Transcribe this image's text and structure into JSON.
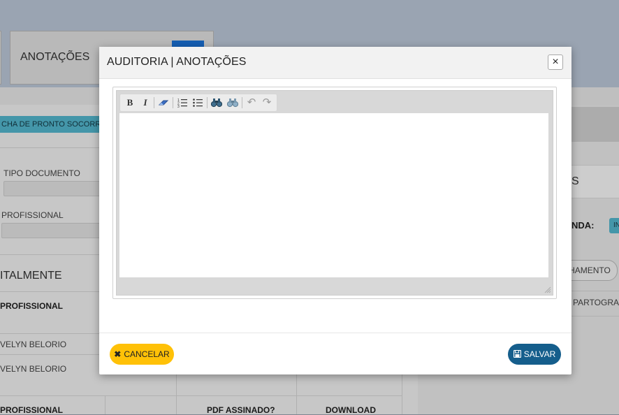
{
  "background": {
    "tab_label": "ANOTAÇÕES",
    "ficha_label": "CHA DE PRONTO SOCORRO (se",
    "tipo_documento_label": "TIPO DOCUMENTO",
    "profissional_label": "PROFISSIONAL",
    "section_title": "ITALMENTE",
    "col_profissional": "PROFISSIONAL",
    "row1_name": "VELYN BELORIO",
    "row2_name": "VELYN BELORIO",
    "col_profissional_2": "PROFISSIONAL",
    "col_pdf_assinado": "PDF ASSINADO?",
    "col_download": "DOWNLOAD",
    "right_s": "S",
    "right_nda": "NDA:",
    "right_badge": "IN",
    "right_pill": "HAMENTO",
    "right_partograma": "PARTOGRAMA"
  },
  "modal": {
    "title": "AUDITORIA | ANOTAÇÕES",
    "close_symbol": "×",
    "toolbar": [
      {
        "name": "bold-button",
        "glyph": "B",
        "icon": "bold-icon"
      },
      {
        "name": "italic-button",
        "glyph": "I",
        "icon": "italic-icon"
      },
      {
        "name": "remove-format-button",
        "glyph": "⌫",
        "icon": "eraser-icon"
      },
      {
        "name": "numbered-list-button",
        "glyph": "1≡",
        "icon": "numbered-list-icon"
      },
      {
        "name": "bulleted-list-button",
        "glyph": "•≡",
        "icon": "bulleted-list-icon"
      },
      {
        "name": "find-button",
        "glyph": "🔍",
        "icon": "binoculars-icon"
      },
      {
        "name": "replace-button",
        "glyph": "🔍",
        "icon": "binoculars-replace-icon"
      },
      {
        "name": "undo-button",
        "glyph": "↶",
        "icon": "undo-icon"
      },
      {
        "name": "redo-button",
        "glyph": "↷",
        "icon": "redo-icon"
      }
    ],
    "cancel_label": "CANCELAR",
    "save_label": "SALVAR"
  },
  "colors": {
    "cancel_bg": "#ffc107",
    "save_bg": "#155e8c",
    "accent_blue": "#1a73d9",
    "ficha_teal": "#54b8cf"
  }
}
